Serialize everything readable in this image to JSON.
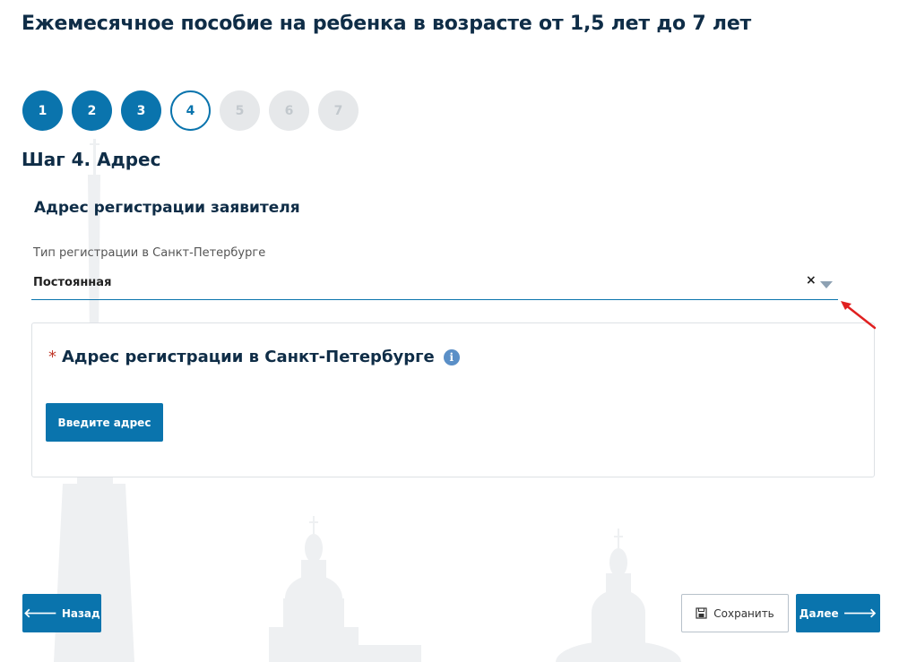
{
  "header": {
    "title": "Ежемесячное пособие на ребенка в возрасте от 1,5 лет до 7 лет"
  },
  "steps": [
    {
      "number": "1",
      "state": "done"
    },
    {
      "number": "2",
      "state": "done"
    },
    {
      "number": "3",
      "state": "done"
    },
    {
      "number": "4",
      "state": "current"
    },
    {
      "number": "5",
      "state": "todo"
    },
    {
      "number": "6",
      "state": "todo"
    },
    {
      "number": "7",
      "state": "todo"
    }
  ],
  "step_title": "Шаг 4. Адрес",
  "section": {
    "title": "Адрес регистрации заявителя",
    "registration_type": {
      "label": "Тип регистрации в Санкт-Петербурге",
      "value": "Постоянная",
      "clear_glyph": "×"
    }
  },
  "address_card": {
    "required_mark": "*",
    "heading": "Адрес регистрации в Санкт-Петербурге",
    "info_glyph": "i",
    "button_label": "Введите адрес"
  },
  "footer": {
    "back_label": "Назад",
    "save_label": "Сохранить",
    "next_label": "Далее"
  },
  "colors": {
    "primary": "#0a74ad",
    "title_text": "#0f2d47",
    "step_inactive": "#e6e8ea",
    "annotation_red": "#e02020"
  },
  "icons": {
    "back": "arrow-left-icon",
    "save": "floppy-disk-icon",
    "next": "arrow-right-icon",
    "info": "info-icon",
    "clear": "clear-icon",
    "dropdown": "caret-down-icon"
  }
}
